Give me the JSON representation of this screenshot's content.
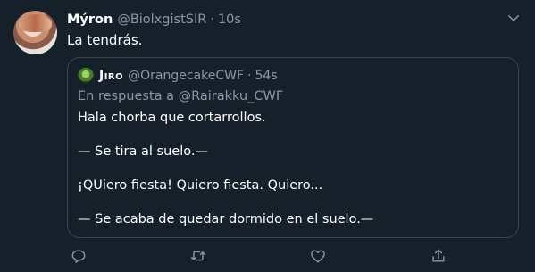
{
  "tweet": {
    "author_name": "Mýron",
    "handle": "@BiolxgistSIR",
    "dot": "·",
    "time": "10s",
    "text": "La tendrás."
  },
  "quoted": {
    "author_name": "Jiro",
    "handle": "@OrangecakeCWF",
    "dot": "·",
    "time": "54s",
    "reply_prefix": "En respuesta a",
    "reply_mention": "@Rairakku_CWF",
    "lines": [
      "Hala chorba que cortarrollos.",
      "— Se tira al suelo.—",
      "¡QUiero fiesta! Quiero fiesta. Quiero...",
      "— Se acaba de quedar dormido en el suelo.—"
    ]
  },
  "icons": {
    "more": "chevron-down-icon",
    "reply": "comment-icon",
    "retweet": "retweet-icon",
    "like": "heart-icon",
    "share": "share-icon"
  },
  "colors": {
    "background": "#15202b",
    "border": "#38444d",
    "secondary_text": "#8899a6",
    "primary_text": "#ffffff"
  }
}
